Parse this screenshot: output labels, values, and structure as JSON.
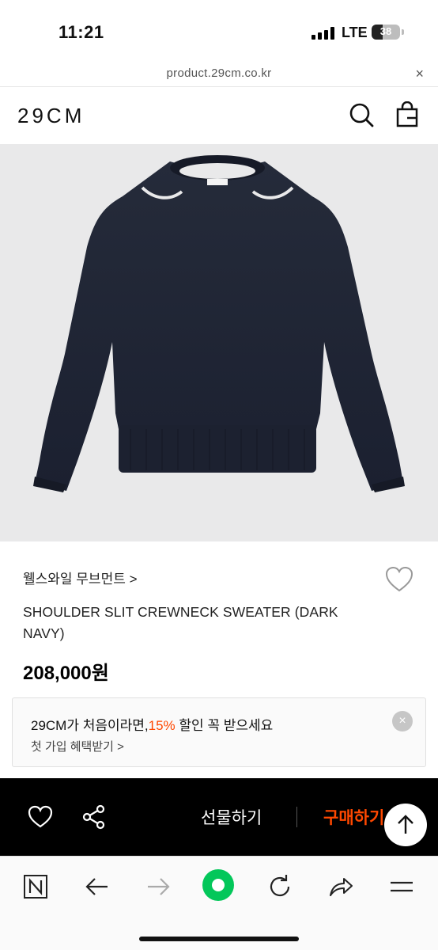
{
  "status_bar": {
    "time": "11:21",
    "network": "LTE",
    "battery": "38",
    "battery_level": 0.38
  },
  "browser": {
    "url": "product.29cm.co.kr",
    "close_symbol": "×"
  },
  "header": {
    "logo": "29CM",
    "icons": [
      "search-icon",
      "shopping-bag-icon"
    ]
  },
  "product": {
    "image_alt": "dark navy crewneck sweater",
    "brand_link": "웰스와일 무브먼트 >",
    "name": "SHOULDER SLIT CREWNECK SWEATER (DARK NAVY)",
    "price": "208,000원"
  },
  "promo": {
    "text_before": "29CM가 처음이라면,",
    "highlight": "15%",
    "text_after": " 할인 꼭 받으세요",
    "sub_link": "첫 가입 혜택받기 >",
    "close_symbol": "×"
  },
  "action_bar": {
    "gift_label": "선물하기",
    "buy_label": "구매하기",
    "icons": [
      "heart-icon",
      "share-icon",
      "arrow-up-icon"
    ]
  },
  "browser_toolbar": {
    "icons": [
      "naver-n-icon",
      "back-arrow-icon",
      "forward-arrow-icon",
      "home-green-icon",
      "reload-icon",
      "share-arrow-icon",
      "menu-icon"
    ]
  },
  "colors": {
    "accent": "#ff4800",
    "naver_green": "#03c75a",
    "product_bg": "#e9e9ea",
    "sweater": "#1e2433"
  }
}
